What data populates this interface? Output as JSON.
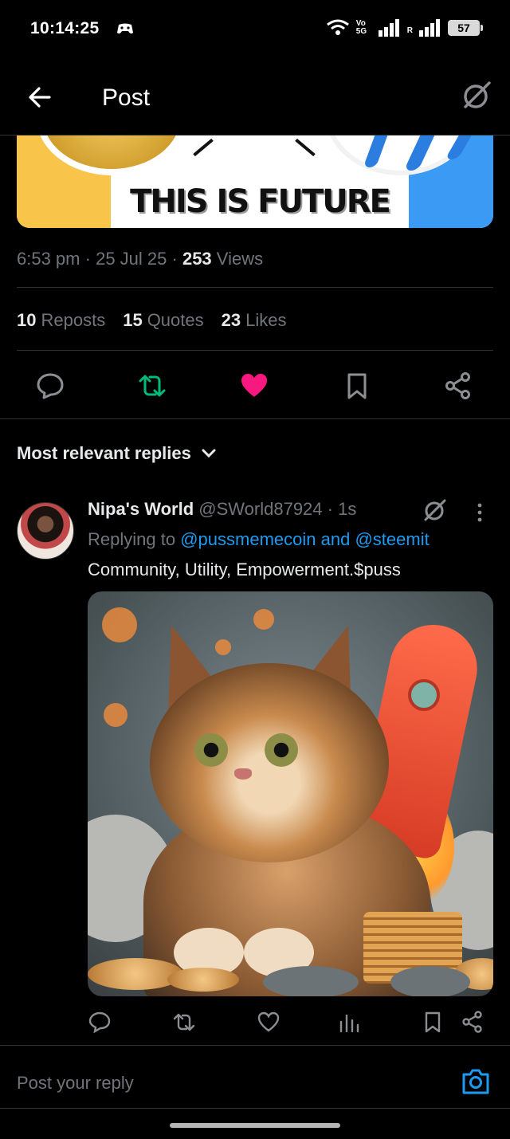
{
  "status_bar": {
    "time": "10:14:25",
    "sim1": "Vo 5G",
    "sim2_label": "R",
    "battery": "57"
  },
  "header": {
    "title": "Post"
  },
  "banner": {
    "text": "THIS IS FUTURE"
  },
  "post_meta": {
    "time": "6:53 pm",
    "date": "25 Jul 25",
    "views_count": "253",
    "views_label": "Views",
    "sep": "·"
  },
  "stats": {
    "reposts_count": "10",
    "reposts_label": "Reposts",
    "quotes_count": "15",
    "quotes_label": "Quotes",
    "likes_count": "23",
    "likes_label": "Likes"
  },
  "colors": {
    "repost_active": "#00ba7c",
    "like_active": "#f91880",
    "link": "#1d9bf0",
    "muted": "#71767b"
  },
  "sort": {
    "label": "Most relevant replies"
  },
  "reply": {
    "name": "Nipa's World",
    "handle": "@SWorld87924",
    "age": "1s",
    "replying_prefix": "Replying to",
    "mention1": "@pussmemecoin",
    "and": "and",
    "mention2": "@steemit",
    "text": "Community, Utility, Empowerment.$puss"
  },
  "compose": {
    "placeholder": "Post your reply"
  }
}
